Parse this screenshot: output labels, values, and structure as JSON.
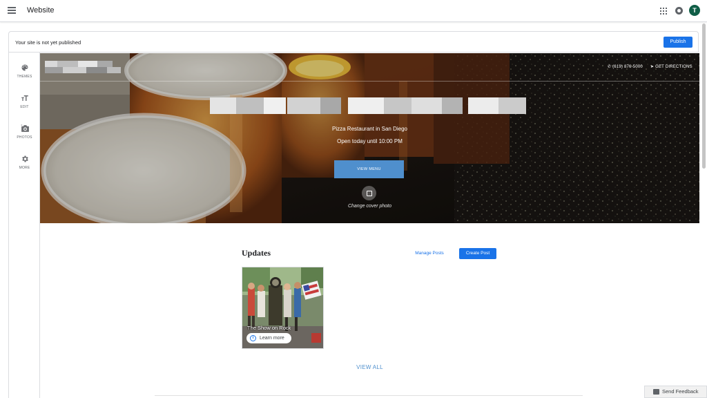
{
  "header": {
    "title": "Website",
    "avatar_initial": "T",
    "icons": [
      "menu-icon",
      "apps-grid-icon",
      "notifications-icon"
    ]
  },
  "banner": {
    "message": "Your site is not yet published",
    "publish_label": "Publish"
  },
  "rail": {
    "items": [
      {
        "label": "THEMES",
        "icon": "palette-icon"
      },
      {
        "label": "EDIT",
        "icon": "text-format-icon"
      },
      {
        "label": "PHOTOS",
        "icon": "camera-icon"
      },
      {
        "label": "MORE",
        "icon": "gear-icon"
      }
    ]
  },
  "hero": {
    "phone": "(619) 876-5000",
    "directions": "GET DIRECTIONS",
    "tagline": "Pizza Restaurant in San Diego",
    "hours": "Open today until 10:00 PM",
    "view_menu_label": "VIEW MENU",
    "change_cover_label": "Change cover photo"
  },
  "updates": {
    "title": "Updates",
    "manage_posts_label": "Manage Posts",
    "create_post_label": "Create Post",
    "post": {
      "caption": "The Show on Rock",
      "learn_more_label": "Learn more"
    },
    "view_all_label": "VIEW ALL"
  },
  "feedback": {
    "label": "Send Feedback"
  },
  "colors": {
    "accent": "#1a73e8",
    "view_menu": "#4f8fcd",
    "avatar_bg": "#0f5d46"
  }
}
